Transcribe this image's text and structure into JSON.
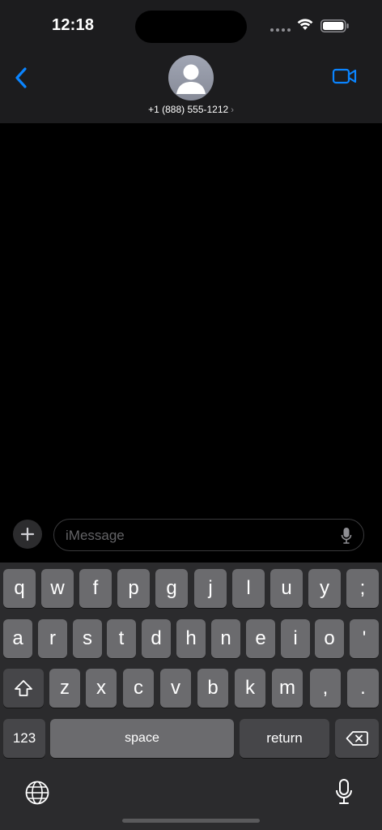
{
  "status_bar": {
    "time": "12:18"
  },
  "header": {
    "contact": "+1 (888) 555-1212",
    "chevron": "›"
  },
  "composer": {
    "placeholder": "iMessage"
  },
  "keyboard": {
    "row1": [
      "q",
      "w",
      "f",
      "p",
      "g",
      "j",
      "l",
      "u",
      "y",
      ";"
    ],
    "row2": [
      "a",
      "r",
      "s",
      "t",
      "d",
      "h",
      "n",
      "e",
      "i",
      "o",
      "'"
    ],
    "row3": [
      "z",
      "x",
      "c",
      "v",
      "b",
      "k",
      "m",
      ",",
      "."
    ],
    "numbers_label": "123",
    "space_label": "space",
    "return_label": "return"
  },
  "icons": {
    "back": "chevron-left-icon",
    "video": "video-camera-icon",
    "plus": "plus-icon",
    "mic": "microphone-icon",
    "shift": "shift-icon",
    "delete": "backspace-icon",
    "globe": "globe-icon"
  },
  "colors": {
    "accent": "#0a84ff",
    "header_bg": "#1c1c1e",
    "keyboard_bg": "#2b2b2d"
  }
}
